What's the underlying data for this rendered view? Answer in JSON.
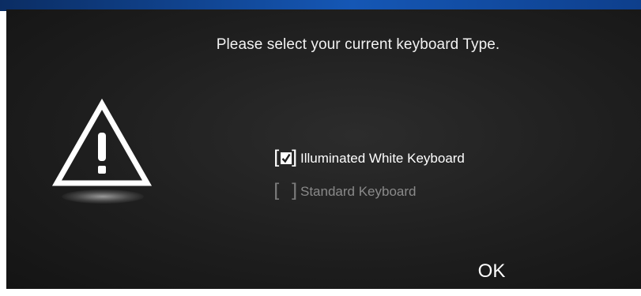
{
  "dialog": {
    "title": "Please select your current keyboard Type.",
    "icon": "warning-icon",
    "options": [
      {
        "label": "Illuminated White Keyboard",
        "checked": true
      },
      {
        "label": "Standard Keyboard",
        "checked": false
      }
    ],
    "ok_label": "OK"
  },
  "colors": {
    "dialog_background": "#1e1e1e",
    "text_primary": "#f2f2f2",
    "text_disabled": "#8a8a8a",
    "desktop_accent": "#1557b5"
  }
}
